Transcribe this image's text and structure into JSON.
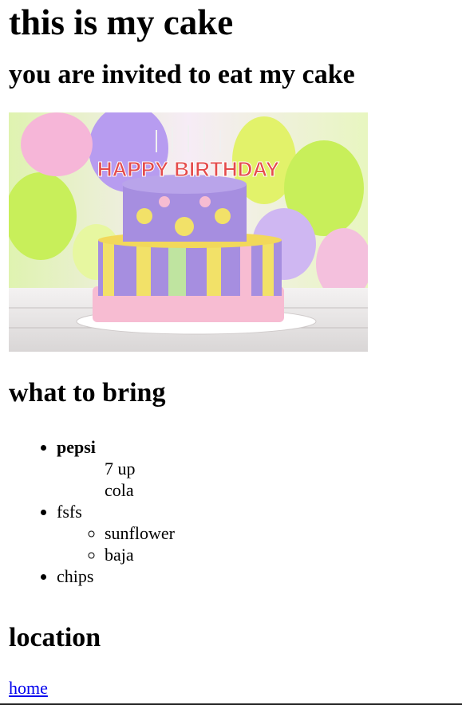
{
  "title": "this is my cake",
  "subtitle": "you are invited to eat my cake",
  "image": {
    "cake_text": "HAPPY BIRTHDAY",
    "colors": {
      "balloon_green": "#c8ef5a",
      "balloon_purple": "#b79cf0",
      "balloon_pink": "#f6b6d8",
      "cake_purple": "#a68ee0",
      "cake_yellow": "#f2e168",
      "ribbon_pink": "#f7bcd2"
    }
  },
  "bring": {
    "heading": "what to bring",
    "items": [
      {
        "label": "pepsi",
        "sub": [
          "7 up",
          "cola"
        ]
      },
      {
        "label": "fsfs",
        "sub": [
          "sunflower",
          "baja"
        ]
      },
      {
        "label": "chips"
      }
    ]
  },
  "location": {
    "heading": "location"
  },
  "nav": {
    "home_label": "home"
  },
  "colors": {
    "link": "#0000ee"
  }
}
